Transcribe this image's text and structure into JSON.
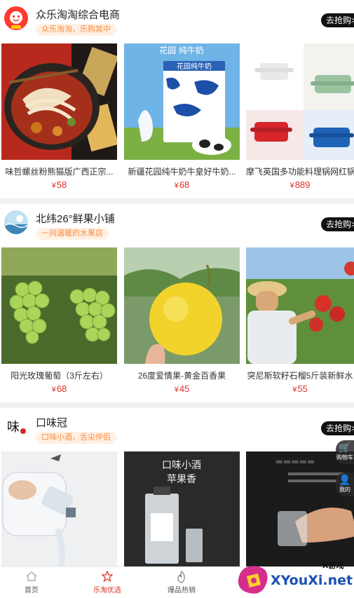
{
  "shops": [
    {
      "name": "众乐淘淘综合电商",
      "tagline": "众乐淘淘，乐购其中",
      "button": "去抢购>",
      "products": [
        {
          "name": "味哲螺丝粉熊猫版广西正宗...",
          "price": "58",
          "image": "snail-noodle-soup"
        },
        {
          "name": "新疆花园纯牛奶牛皇好牛奶...",
          "price": "68",
          "image": "milk-carton-with-cow",
          "banner": "花园  纯牛奶",
          "pack_text": "花园纯牛奶"
        },
        {
          "name": "摩飞英国多功能料理锅网红锅",
          "price": "889",
          "image": "multi-cooker-pots"
        }
      ]
    },
    {
      "name": "北纬26°鲜果小铺",
      "tagline": "一间温暖的水果店",
      "button": "去抢购>",
      "products": [
        {
          "name": "阳光玫瑰葡萄（3斤左右）",
          "price": "68",
          "image": "green-grapes"
        },
        {
          "name": "26度爱情果-黄金百香果",
          "price": "45",
          "image": "yellow-passion-fruit"
        },
        {
          "name": "突尼斯软籽石榴5斤装新鲜水",
          "price": "55",
          "image": "pomegranate-picker"
        }
      ]
    },
    {
      "name": "口味冠",
      "tagline": "口味小酒，舌尖伴侣",
      "button": "去抢购>",
      "products": [
        {
          "name": "",
          "price": "",
          "image": "pouring-liquor-bottle"
        },
        {
          "name": "",
          "price": "",
          "image": "apple-liquor-bottle",
          "poster_title": "口味小酒",
          "poster_sub": "苹果香"
        },
        {
          "name": "",
          "price": "",
          "image": "glass-in-hand"
        }
      ]
    }
  ],
  "currency": "¥",
  "float_buttons": [
    {
      "label": "购物车",
      "icon": "cart-icon"
    },
    {
      "label": "我的",
      "icon": "user-icon"
    }
  ],
  "nav": [
    {
      "label": "首页",
      "icon": "home-icon",
      "active": false
    },
    {
      "label": "乐淘优选",
      "icon": "star-icon",
      "active": true
    },
    {
      "label": "爆品热销",
      "icon": "fire-icon",
      "active": false
    }
  ],
  "watermark": {
    "text": "XYouXi.net",
    "sub": "X游戏"
  },
  "colors": {
    "price": "#e02e24",
    "tag_bg": "#fff0e2",
    "tag_text": "#ff8a3d",
    "nav_active": "#e02e24"
  }
}
